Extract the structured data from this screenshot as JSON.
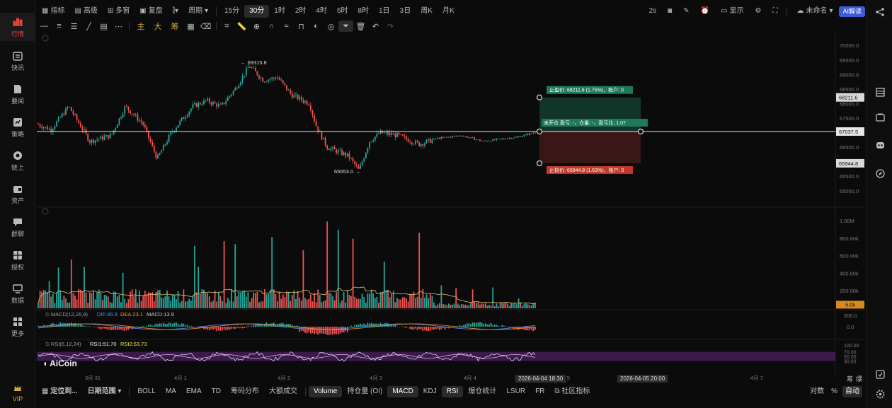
{
  "sidebar": {
    "items": [
      {
        "label": "行情",
        "icon": "bar-chart-icon",
        "active": true
      },
      {
        "label": "快讯",
        "icon": "flash-news-icon"
      },
      {
        "label": "要闻",
        "icon": "document-icon"
      },
      {
        "label": "策略",
        "icon": "strategy-icon"
      },
      {
        "label": "链上",
        "icon": "chain-icon"
      },
      {
        "label": "资产",
        "icon": "wallet-icon"
      },
      {
        "label": "群聊",
        "icon": "chat-icon"
      },
      {
        "label": "授权",
        "icon": "auth-icon"
      },
      {
        "label": "数据",
        "icon": "monitor-icon"
      },
      {
        "label": "更多",
        "icon": "grid-icon"
      }
    ],
    "vip_label": "VIP"
  },
  "toolbar": {
    "indicators": "指标",
    "advanced": "高级",
    "multi": "多窗",
    "replay": "复盘",
    "period": "周期",
    "timeframes": [
      "15分",
      "30分",
      "1时",
      "2时",
      "4时",
      "6时",
      "8时",
      "1日",
      "3日",
      "周K",
      "月K"
    ],
    "active_timeframe": "30分",
    "refresh": "2s",
    "display": "显示",
    "account": "未命名",
    "ai": "AI解读"
  },
  "drawbar": {
    "main": "主",
    "big": "大",
    "chips": "筹"
  },
  "chart_data": {
    "type": "candlestick",
    "price_axis": [
      "70000.0",
      "69500.0",
      "69000.0",
      "68500.0",
      "68000.0",
      "67500.0",
      "67000.0",
      "66500.0",
      "66000.0",
      "65500.0",
      "65000.0"
    ],
    "ylim": [
      64800,
      70200
    ],
    "current_price": "67037.5",
    "take_profit_price": "68211.6",
    "stop_loss_price": "65944.8",
    "high_marker": "69315.8",
    "low_marker": "65653.0",
    "x_dates": [
      "3月 31",
      "4月 1",
      "4月 2",
      "4月 3",
      "4月 4",
      "4月 5",
      "4月 6",
      "4月 7"
    ],
    "take_profit_label": "止盈价: 68211.6 (1.75%)，账户: 0",
    "stop_loss_label": "止损价: 65944.8 (1.63%)，账户: 0",
    "position_label": "未开仓 盈亏: -，仓量: -，盈亏比: 1.07",
    "volume_axis": [
      "1.00M",
      "800.00k",
      "600.00k",
      "400.00k",
      "200.00k"
    ],
    "volume_current": "5.0k",
    "macd": {
      "label": "MACD(12,26,9)",
      "dif": "DIF:36.9",
      "dea": "DEA:23.1",
      "macd": "MACD:13.9",
      "axis": [
        "500.0",
        "0.0"
      ]
    },
    "rsi": {
      "label": "RSI(6,12,24)",
      "rsi1": "RSI1:51.70",
      "rsi2": "RSI2:53.73",
      "axis": [
        "100.00",
        "70.00",
        "50.00",
        "30.00"
      ]
    },
    "crosshair_time": "2026-04-04 18:30",
    "cursor_time": "2026-04-05 20:00"
  },
  "brand": "AiCoin",
  "bottombar": {
    "locate": "定位到...",
    "range": "日期范围",
    "tabs": [
      "BOLL",
      "MA",
      "EMA",
      "TD",
      "筹码分布",
      "大额成交"
    ],
    "tabs2": [
      "Volume",
      "持仓量 (OI)",
      "MACD",
      "KDJ",
      "RSI",
      "爆仓统计",
      "LSUR",
      "FR"
    ],
    "community": "社区指标",
    "log": "对数",
    "percent": "%",
    "auto": "自动"
  },
  "right_corner": [
    "筹",
    "爆"
  ],
  "colors": {
    "up": "#26a69a",
    "down": "#ef5350",
    "accent": "#e8453c",
    "tp": "#1f7a5c",
    "sl": "#c0392b"
  }
}
